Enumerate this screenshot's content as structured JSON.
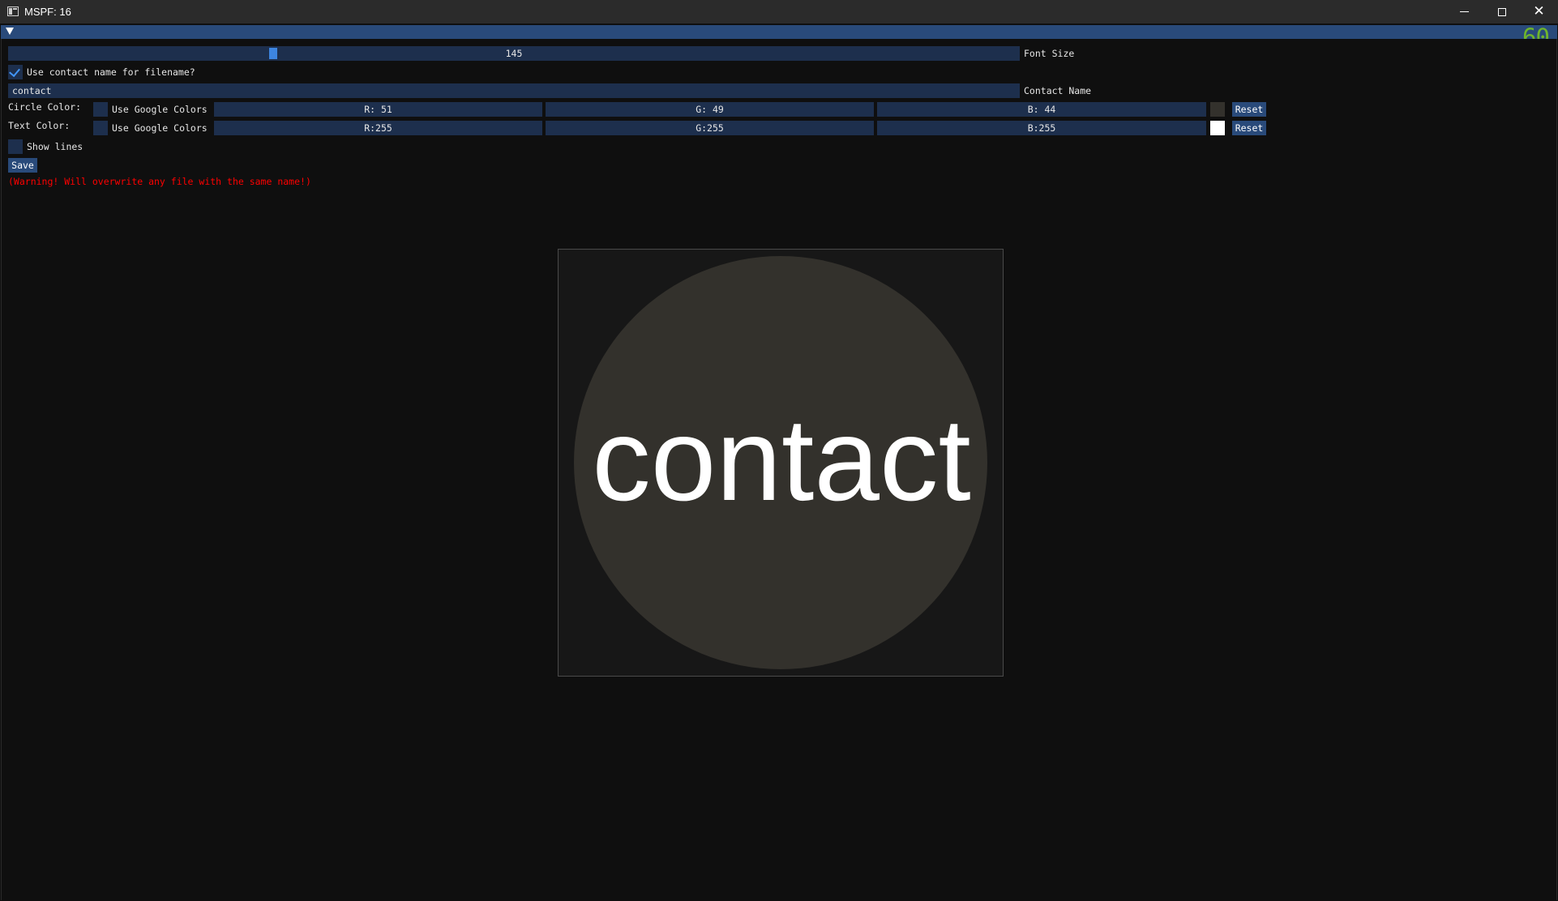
{
  "window": {
    "title": "MSPF: 16",
    "close_glyph": "✕"
  },
  "fps_counter": "60",
  "controls": {
    "font_size": {
      "value": "145",
      "label": "Font Size",
      "fraction": 0.26
    },
    "use_contact_name_filename": {
      "label": "Use contact name for filename?",
      "checked": true
    },
    "contact_name": {
      "value": "contact",
      "label": "Contact Name"
    },
    "circle_color": {
      "label": "Circle Color:",
      "google_label": "Use Google Colors",
      "google_checked": false,
      "r": "R: 51",
      "g": "G: 49",
      "b": "B: 44",
      "swatch": "#33312c",
      "reset_label": "Reset"
    },
    "text_color": {
      "label": "Text Color:",
      "google_label": "Use Google Colors",
      "google_checked": false,
      "r": "R:255",
      "g": "G:255",
      "b": "B:255",
      "swatch": "#ffffff",
      "reset_label": "Reset"
    },
    "show_lines": {
      "label": "Show lines",
      "checked": false
    },
    "save_label": "Save",
    "warning": "(Warning! Will overwrite any file with the same name!)"
  },
  "preview": {
    "text": "contact",
    "circle_color": "#33312c",
    "text_color": "#ffffff"
  },
  "colors": {
    "frame_bg": "#1d2f4d",
    "title_accent": "#294a7a",
    "slider_grab": "#3d85e0",
    "warning": "#ff0000",
    "fps": "#6fb52c"
  }
}
